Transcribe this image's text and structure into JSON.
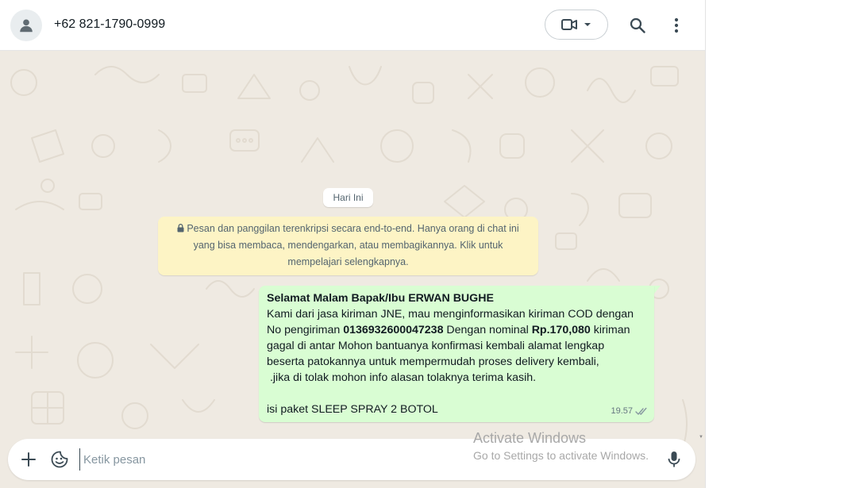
{
  "header": {
    "contact": "+62 821-1790-0999",
    "avatar_icon": "person-icon",
    "call_icon": "video-camera-icon",
    "call_menu_icon": "chevron-down-icon",
    "search_icon": "search-icon",
    "menu_icon": "more-vertical-icon"
  },
  "chat": {
    "date_chip": "Hari Ini",
    "encryption_notice": "Pesan dan panggilan terenkripsi secara end-to-end. Hanya orang di chat ini yang bisa membaca, mendengarkan, atau membagikannya. Klik untuk mempelajari selengkapnya.",
    "message": {
      "greeting": "Selamat Malam Bapak/Ibu ERWAN BUGHE",
      "line_a": "Kami dari jasa kiriman JNE, mau menginformasikan kiriman COD dengan",
      "no_label": "No pengiriman ",
      "tracking_number": "0136932600047238",
      "nominal_label": " Dengan nominal ",
      "amount": "Rp.170,080",
      "line_b_tail": " kiriman",
      "line_c": "gagal di antar Mohon bantuanya konfirmasi kembali alamat lengkap",
      "line_d": "beserta patokannya untuk mempermudah proses delivery kembali,",
      "line_e": " .jika di tolak mohon info alasan tolaknya terima kasih.",
      "line_f": "isi paket SLEEP SPRAY 2 BOTOL",
      "time": "19.57",
      "status_icon": "double-check-icon"
    }
  },
  "composer": {
    "placeholder": "Ketik pesan",
    "value": "",
    "attach_icon": "plus-icon",
    "sticker_icon": "sticker-icon",
    "mic_icon": "microphone-icon"
  },
  "watermark": {
    "title": "Activate Windows",
    "subtitle": "Go to Settings to activate Windows."
  },
  "colors": {
    "wallpaper": "#efeae2",
    "outgoing_bubble": "#d9fdd3",
    "notice_bg": "#fdf4c5",
    "header_bg": "#ffffff"
  }
}
